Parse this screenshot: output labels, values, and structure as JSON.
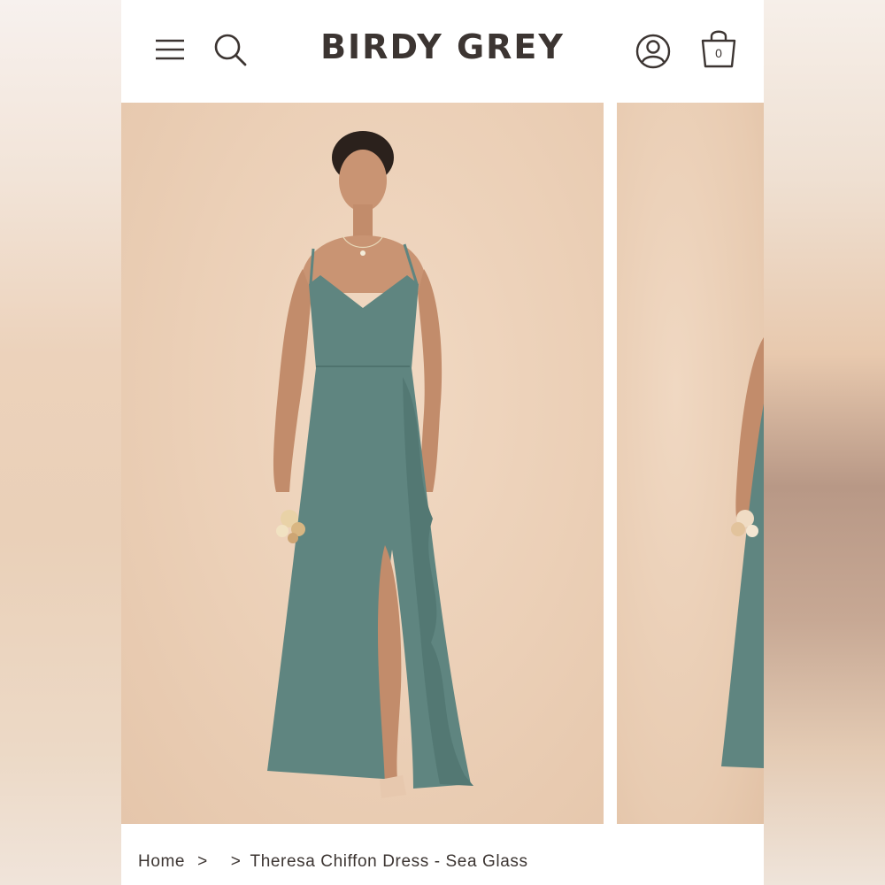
{
  "header": {
    "brand": "BIRDY GREY",
    "bag_count": "0",
    "icons": [
      "menu-icon",
      "search-icon",
      "account-icon",
      "shopping-bag-icon"
    ]
  },
  "gallery": {
    "dress_color": "#5f8580",
    "background_color": "#ecd1b8"
  },
  "breadcrumb": {
    "home": "Home",
    "sep1": ">",
    "sep2": ">",
    "current": "Theresa Chiffon Dress - Sea Glass"
  }
}
